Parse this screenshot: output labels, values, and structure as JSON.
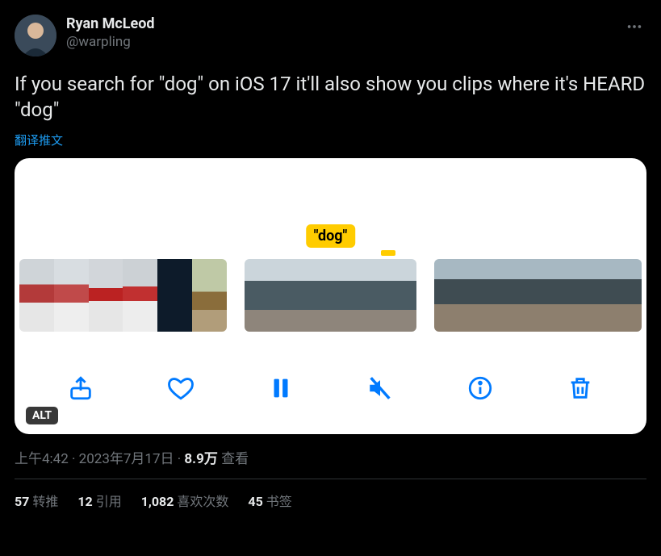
{
  "header": {
    "name": "Ryan McLeod",
    "handle": "@warpling"
  },
  "body_text": "If you search for \"dog\" on iOS 17 it'll also show you clips where it's HEARD \"dog\"",
  "translate_label": "翻译推文",
  "media": {
    "tooltip_text": "\"dog\"",
    "alt_badge": "ALT"
  },
  "meta": {
    "time": "上午4:42",
    "separator": " · ",
    "date": "2023年7月17日",
    "views_number": "8.9万",
    "views_label": " 查看"
  },
  "stats": {
    "retweets_num": "57",
    "retweets_label": "转推",
    "quotes_num": "12",
    "quotes_label": "引用",
    "likes_num": "1,082",
    "likes_label": "喜欢次数",
    "bookmarks_num": "45",
    "bookmarks_label": "书签"
  }
}
